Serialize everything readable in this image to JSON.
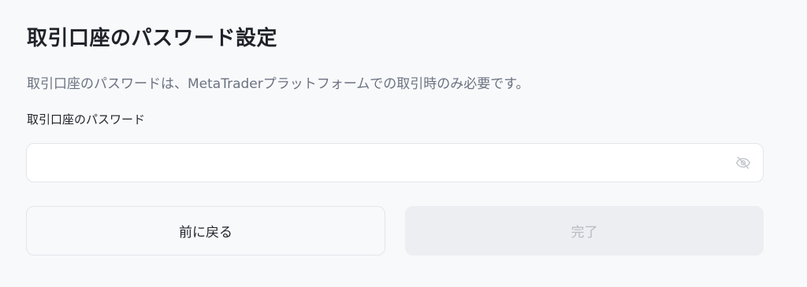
{
  "form": {
    "title": "取引口座のパスワード設定",
    "description": "取引口座のパスワードは、MetaTraderプラットフォームでの取引時のみ必要です。",
    "password_label": "取引口座のパスワード",
    "password_value": "",
    "password_placeholder": "",
    "visibility_icon": "eye-off-icon"
  },
  "buttons": {
    "back_label": "前に戻る",
    "done_label": "完了",
    "done_enabled": false
  },
  "colors": {
    "background": "#f8f9fb",
    "title_text": "#1f2329",
    "description_text": "#6b7280",
    "border": "#e3e6ea",
    "disabled_button_bg": "#eceef1",
    "disabled_button_text": "#b6bac1",
    "icon": "#c4c8ce"
  }
}
